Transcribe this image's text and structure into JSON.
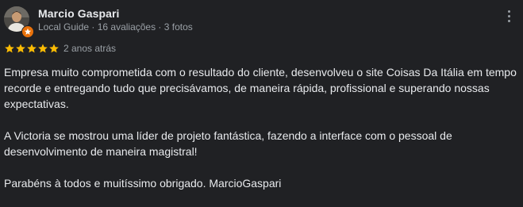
{
  "reviewer": {
    "name": "Marcio Gaspari",
    "meta": "Local Guide · 16 avaliações · 3 fotos"
  },
  "rating": {
    "stars": 5,
    "max": 5,
    "color": "#fbbc04"
  },
  "date": "2 anos atrás",
  "body": {
    "p1": "Empresa muito comprometida com o resultado do cliente, desenvolveu o site Coisas Da Itália em tempo recorde e entregando tudo que precisávamos, de maneira rápida, profissional e superando nossas expectativas.",
    "p2": "A Victoria se mostrou uma líder de projeto fantástica, fazendo a interface com o pessoal de desenvolvimento de maneira magistral!",
    "p3": "Parabéns à todos e muitíssimo obrigado. MarcioGaspari"
  },
  "icons": {
    "avatar": "profile-photo",
    "badge": "local-guide-star-icon",
    "more": "more-vertical-icon",
    "star": "star-icon"
  }
}
